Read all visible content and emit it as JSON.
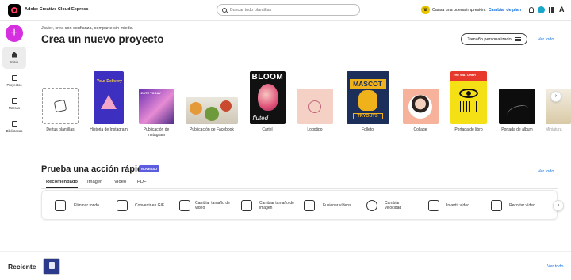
{
  "app": {
    "title": "Adobe Creative Cloud Express"
  },
  "search": {
    "placeholder": "Buscar todo plantillas"
  },
  "header": {
    "cause_text": "Causa una buena impresión.",
    "cause_link": "Cambiar de plan"
  },
  "sidebar": {
    "items": [
      {
        "label": "Inicio",
        "icon": "home-icon"
      },
      {
        "label": "Proyectos",
        "icon": "document-icon"
      },
      {
        "label": "Marcas",
        "icon": "brand-icon"
      },
      {
        "label": "Bibliotecas",
        "icon": "library-icon"
      }
    ]
  },
  "main": {
    "welcome": "Javier, crea con confianza, comparte sin miedo.",
    "title": "Crea un nuevo proyecto",
    "custom_size": "Tamaño personalizado",
    "see_all": "Ver todo",
    "templates": [
      {
        "label": "De tus plantillas"
      },
      {
        "label": "Historia de Instagram",
        "text": "Your Delivery"
      },
      {
        "label": "Publicación de Instagram",
        "text": "ZOTE TODAY"
      },
      {
        "label": "Publicación de Facebook"
      },
      {
        "label": "Cartel",
        "text": "BLOOM",
        "text2": "fluted"
      },
      {
        "label": "Logotipo"
      },
      {
        "label": "Folleto",
        "text": "MASCOT",
        "text2": "TRYOUTS"
      },
      {
        "label": "Collage"
      },
      {
        "label": "Portada de libro",
        "text": "THE WATCHER"
      },
      {
        "label": "Portada de álbum"
      },
      {
        "label": "Miniatura"
      }
    ]
  },
  "quick": {
    "title": "Prueba una acción rápida",
    "badge": "NOVEDAD",
    "see_all": "Ver todo",
    "tabs": [
      "Recomendado",
      "Imagen",
      "Vídeo",
      "PDF"
    ],
    "actions": [
      {
        "label": "Eliminar fondo",
        "icon": "image-icon"
      },
      {
        "label": "Convertir en GIF",
        "icon": "gif-icon"
      },
      {
        "label": "Cambiar tamaño de vídeo",
        "icon": "resize-video-icon"
      },
      {
        "label": "Cambiar tamaño de imagen",
        "icon": "resize-image-icon"
      },
      {
        "label": "Fusionar vídeos",
        "icon": "merge-video-icon"
      },
      {
        "label": "Cambiar velocidad",
        "icon": "speed-icon"
      },
      {
        "label": "Invertir vídeo",
        "icon": "reverse-video-icon"
      },
      {
        "label": "Recortar vídeo",
        "icon": "trim-video-icon"
      }
    ]
  },
  "recent": {
    "title": "Reciente",
    "see_all": "Ver todo"
  },
  "colors": {
    "accent": "#1473e6",
    "create": "#d52fe0",
    "badge": "#5c5ce0"
  }
}
